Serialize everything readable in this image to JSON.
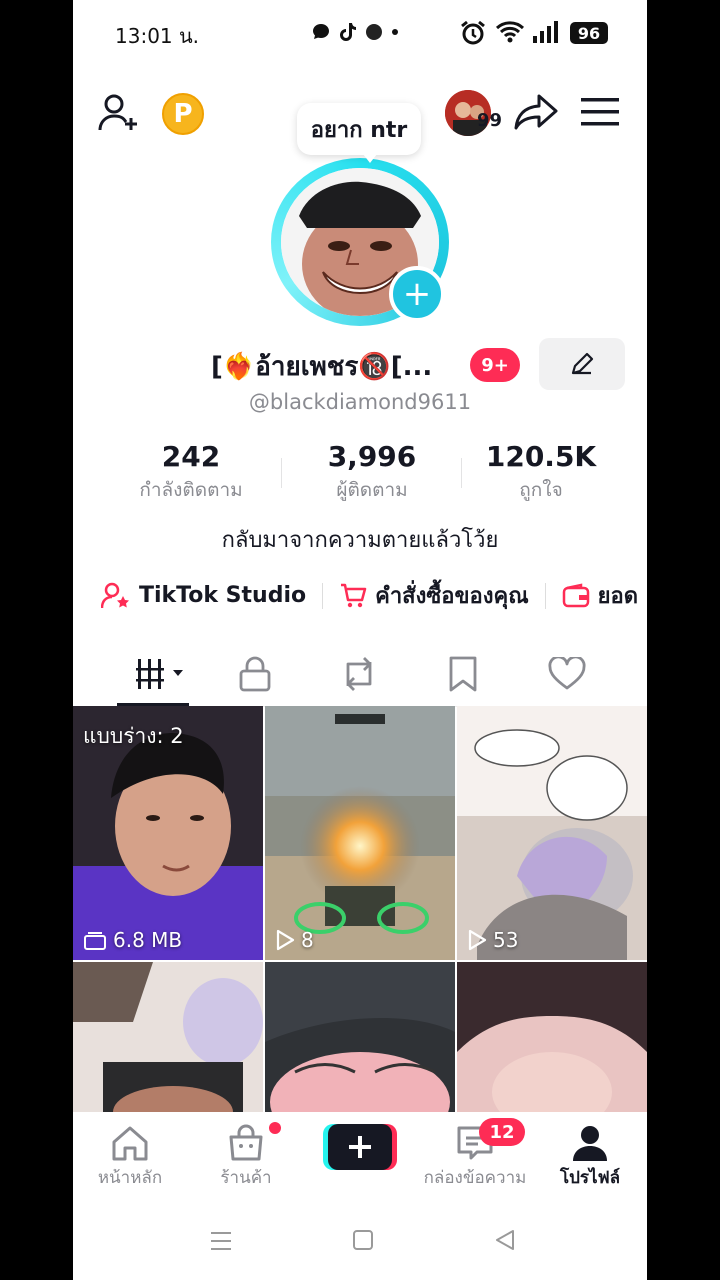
{
  "status_bar": {
    "time": "13:01 น.",
    "battery": "96"
  },
  "header": {
    "points_label": "P",
    "followers_avatar_count": "99"
  },
  "profile": {
    "note_bubble": "อยาก ntr",
    "display_name": "[❤️‍🔥อ้ายเพชร🔞[...",
    "name_badge": "9+",
    "handle": "@blackdiamond9611",
    "bio": "กลับมาจากความตายแล้วโว้ย"
  },
  "stats": [
    {
      "value": "242",
      "label": "กำลังติดตาม"
    },
    {
      "value": "3,996",
      "label": "ผู้ติดตาม"
    },
    {
      "value": "120.5K",
      "label": "ถูกใจ"
    }
  ],
  "links": {
    "studio": "TikTok Studio",
    "orders": "คำสั่งซื้อของคุณ",
    "wallet": "ยอด"
  },
  "tabs": [
    "videos-grid",
    "private",
    "reposts",
    "favorites",
    "liked"
  ],
  "grid": [
    {
      "top_label": "แบบร่าง: 2",
      "bottom_label": "6.8 MB",
      "kind": "drafts"
    },
    {
      "top_label": "",
      "bottom_label": "8",
      "kind": "views"
    },
    {
      "top_label": "",
      "bottom_label": "53",
      "kind": "views"
    },
    {
      "top_label": "",
      "bottom_label": "",
      "kind": "none"
    },
    {
      "top_label": "",
      "bottom_label": "",
      "kind": "none"
    },
    {
      "top_label": "",
      "bottom_label": "",
      "kind": "none"
    }
  ],
  "nav": {
    "home": "หน้าหลัก",
    "shop": "ร้านค้า",
    "inbox": "กล่องข้อความ",
    "inbox_badge": "12",
    "profile": "โปรไฟล์"
  },
  "colors": {
    "accent": "#fe2c55",
    "cyan": "#25f4ee",
    "ring": "#20c4e0",
    "coin": "#f7b51d"
  }
}
